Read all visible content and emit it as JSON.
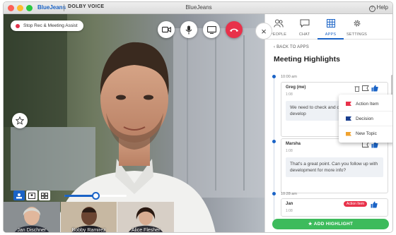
{
  "titlebar": {
    "brand": "BlueJeans",
    "partner": "DOLBY VOICE",
    "title": "BlueJeans",
    "help_label": "Help",
    "help_icon_glyph": "?"
  },
  "video": {
    "stop_rec_label": "Stop Rec & Meeting Assist",
    "controls": [
      "video-camera-icon",
      "microphone-icon",
      "screen-share-icon",
      "end-call-icon"
    ],
    "close_glyph": "×",
    "volume_level": 0.5,
    "participants": [
      {
        "name": "Jan Dischner"
      },
      {
        "name": "Bobby Ramirez"
      },
      {
        "name": "Alice Flesher"
      }
    ]
  },
  "panel": {
    "tabs": [
      {
        "label": "PEOPLE",
        "icon": "people-icon",
        "active": false
      },
      {
        "label": "CHAT",
        "icon": "chat-icon",
        "active": false
      },
      {
        "label": "APPS",
        "icon": "apps-icon",
        "active": true
      },
      {
        "label": "SETTINGS",
        "icon": "gear-icon",
        "active": false
      }
    ],
    "back_label": "BACK TO APPS",
    "title": "Meeting Highlights",
    "highlights": [
      {
        "time": "10:00 am",
        "name": "Greg (me)",
        "ts": "1:08",
        "message": "We need to check and designs meet develop"
      },
      {
        "name": "Marsha",
        "ts": "1:08",
        "message": "That's a great point. Can you follow up with development for more info?"
      },
      {
        "time": "10:28 am",
        "name": "Jan",
        "ts": "1:08",
        "badge": "Action Item"
      }
    ],
    "dropdown": [
      {
        "label": "Action Item",
        "color": "#e8314a"
      },
      {
        "label": "Decision",
        "color": "#1a3f8f"
      },
      {
        "label": "New Topic",
        "color": "#f0a22e"
      }
    ],
    "add_button": "ADD HIGHLIGHT",
    "add_button_icon": "star-icon"
  },
  "colors": {
    "accent": "#1a63c6",
    "end_call": "#e8314a",
    "add_button": "#3dbb5c"
  }
}
